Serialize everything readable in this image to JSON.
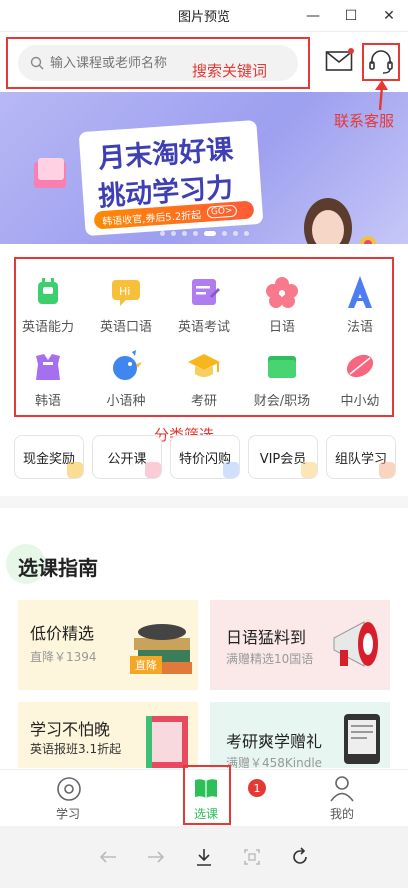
{
  "window": {
    "title": "图片预览",
    "controls": [
      "minimize-icon",
      "maximize-icon",
      "close-icon"
    ]
  },
  "search": {
    "placeholder": "输入课程或老师名称",
    "annotation": "搜索关键词"
  },
  "header": {
    "mail_icon": "mail-icon",
    "service_icon": "headset-icon",
    "service_annotation": "联系客服"
  },
  "banner": {
    "line1": "月末淘好课",
    "line2": "挑动学习力",
    "promo": "韩语收官,券后5.2折起",
    "promo_cta": "GO>",
    "slides": 8,
    "active_slide": 5
  },
  "categories": {
    "annotation": "分类筛选",
    "items": [
      {
        "label": "英语能力",
        "icon": "robot-icon"
      },
      {
        "label": "英语口语",
        "icon": "speech-bubble-icon"
      },
      {
        "label": "英语考试",
        "icon": "exam-paper-icon"
      },
      {
        "label": "日语",
        "icon": "sakura-icon"
      },
      {
        "label": "法语",
        "icon": "eiffel-tower-icon"
      },
      {
        "label": "韩语",
        "icon": "hanbok-icon"
      },
      {
        "label": "小语种",
        "icon": "bird-icon"
      },
      {
        "label": "考研",
        "icon": "graduation-cap-icon"
      },
      {
        "label": "财会/职场",
        "icon": "folder-icon"
      },
      {
        "label": "中小幼",
        "icon": "leaf-icon"
      }
    ]
  },
  "quick_links": [
    {
      "label": "现金奖励"
    },
    {
      "label": "公开课"
    },
    {
      "label": "特价闪购"
    },
    {
      "label": "VIP会员"
    },
    {
      "label": "组队学习"
    }
  ],
  "guide": {
    "title": "选课指南",
    "tiles": [
      {
        "name": "低价精选",
        "sub": "直降￥1394",
        "tag": "直降"
      },
      {
        "name": "日语猛料到",
        "sub": "满赠精选10国语"
      },
      {
        "name": "学习不怕晚",
        "sub": "英语报班3.1折起"
      },
      {
        "name": "考研爽学赠礼",
        "sub": "满赠￥458Kindle"
      }
    ]
  },
  "tabbar": {
    "items": [
      {
        "label": "学习"
      },
      {
        "label": "选课"
      },
      {
        "label": "我的"
      }
    ],
    "badge": "1"
  },
  "viewer": {
    "tools": [
      "back-arrow-icon",
      "forward-arrow-icon",
      "download-icon",
      "crop-icon",
      "rotate-icon"
    ]
  },
  "colors": {
    "annotation": "#e53935",
    "banner": "#9d9ff0",
    "brand_green": "#2dbf5a"
  }
}
